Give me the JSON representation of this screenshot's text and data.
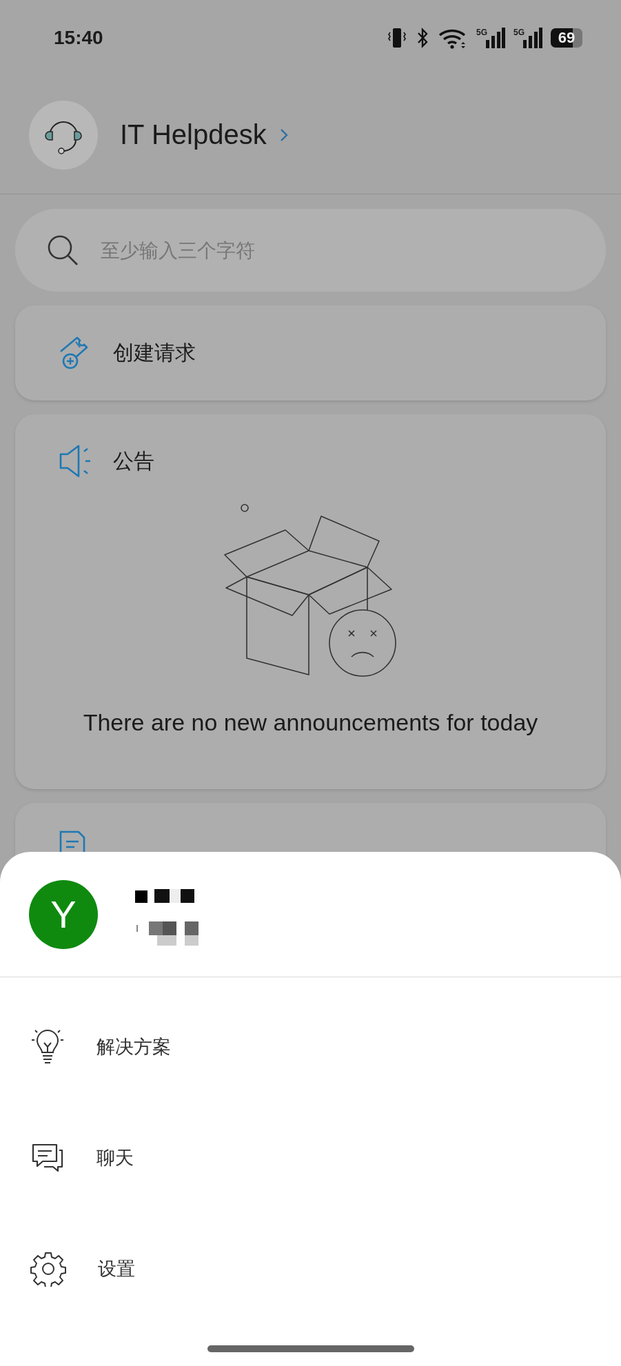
{
  "status_bar": {
    "time": "15:40",
    "network_labels": [
      "5G",
      "5G"
    ],
    "battery": "69"
  },
  "header": {
    "title": "IT Helpdesk"
  },
  "search": {
    "placeholder": "至少输入三个字符"
  },
  "cards": [
    {
      "kind": "action",
      "title": "创建请求"
    },
    {
      "kind": "announcements",
      "title": "公告",
      "empty_text": "There are no new announcements for today"
    },
    {
      "kind": "covered"
    }
  ],
  "sheet": {
    "avatar_letter": "Y",
    "menu": [
      {
        "label": "解决方案"
      },
      {
        "label": "聊天"
      },
      {
        "label": "设置"
      }
    ]
  }
}
